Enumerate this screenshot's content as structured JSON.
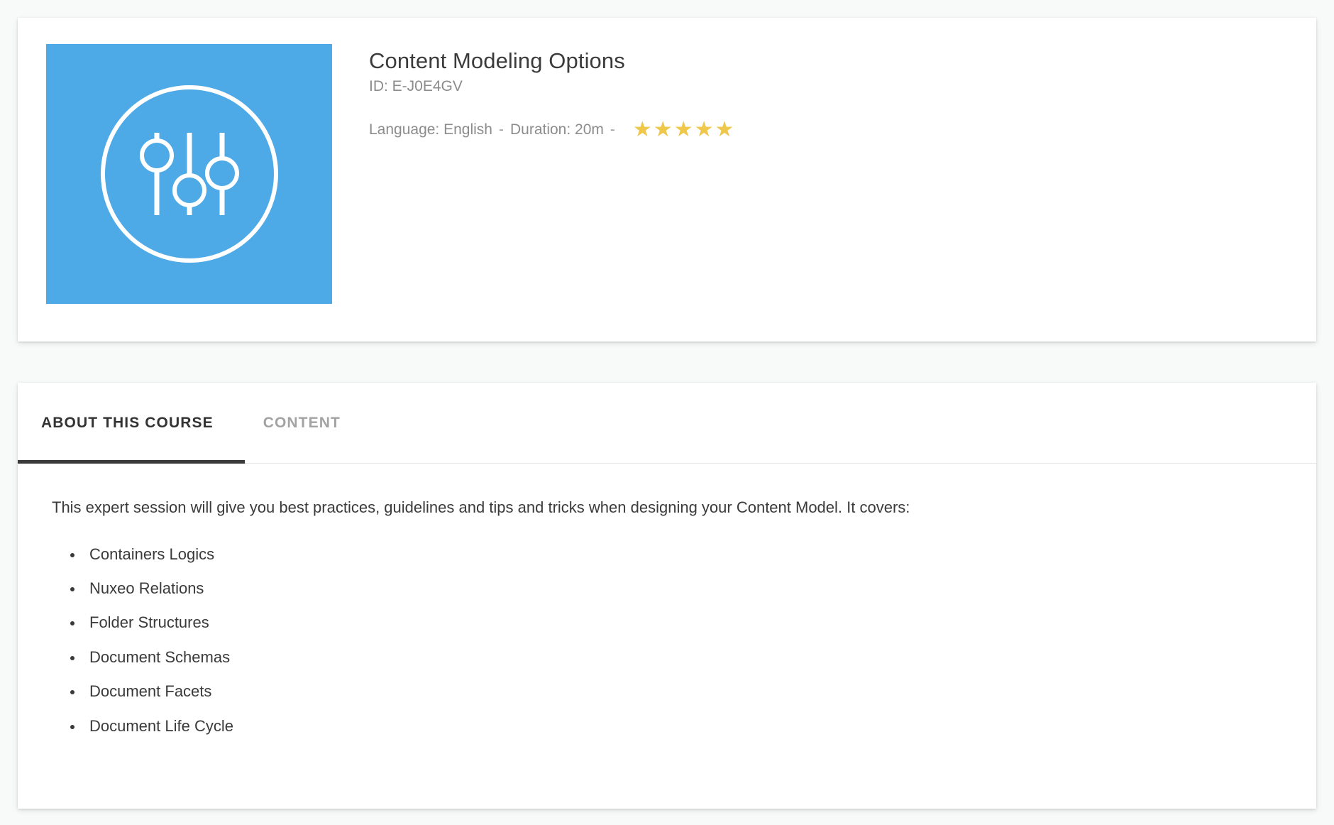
{
  "course": {
    "title": "Content Modeling Options",
    "id_label": "ID: E-J0E4GV",
    "language_label": "Language: English",
    "separator": "-",
    "duration_label": "Duration: 20m",
    "separator2": "-",
    "rating": 5,
    "rating_max": 5,
    "star_glyph": "★",
    "thumbnail_icon": "sliders-icon",
    "thumbnail_color": "#4daae6",
    "star_color": "#eec74b"
  },
  "tabs": [
    {
      "label": "ABOUT THIS COURSE",
      "active": true
    },
    {
      "label": "CONTENT",
      "active": false
    }
  ],
  "about": {
    "intro": "This expert session will give you best practices, guidelines and tips and tricks when designing your Content Model. It covers:",
    "bullets": [
      "Containers Logics",
      "Nuxeo Relations",
      "Folder Structures",
      "Document Schemas",
      "Document Facets",
      "Document Life Cycle"
    ]
  }
}
